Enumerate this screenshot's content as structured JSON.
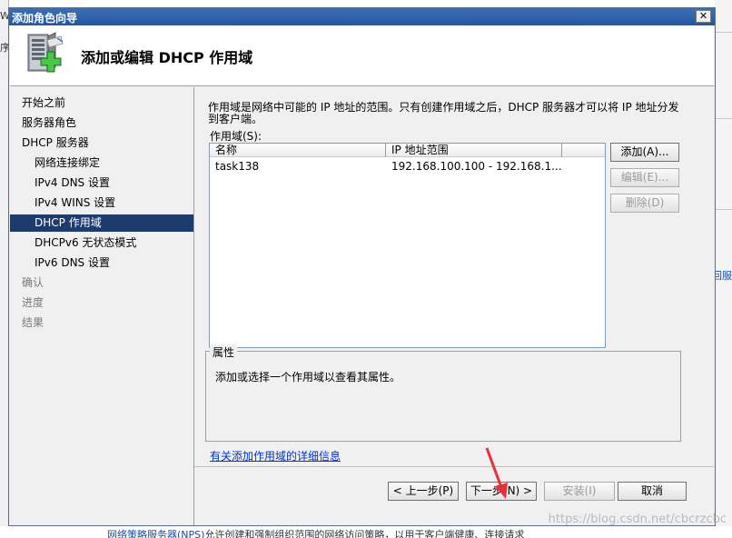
{
  "background": {
    "left_fragments": [
      "W:",
      "序"
    ],
    "right_fragment": "回服",
    "bottom_text_link": "网络策略服务器(NPS)",
    "bottom_text_rest": "允许创建和强制组织范围的网络访问策略，以用于客户端健康、连接请求"
  },
  "watermark": "https://blog.csdn.net/cbcrzcbc",
  "dialog": {
    "title": "添加角色向导",
    "close_glyph": "✕",
    "header_title": "添加或编辑 DHCP 作用域",
    "nav": [
      {
        "label": "开始之前",
        "state": "normal",
        "indent": 0
      },
      {
        "label": "服务器角色",
        "state": "normal",
        "indent": 0
      },
      {
        "label": "DHCP 服务器",
        "state": "normal",
        "indent": 0
      },
      {
        "label": "网络连接绑定",
        "state": "normal",
        "indent": 1
      },
      {
        "label": "IPv4 DNS 设置",
        "state": "normal",
        "indent": 1
      },
      {
        "label": "IPv4 WINS 设置",
        "state": "normal",
        "indent": 1
      },
      {
        "label": "DHCP 作用域",
        "state": "active",
        "indent": 1
      },
      {
        "label": "DHCPv6 无状态模式",
        "state": "normal",
        "indent": 1
      },
      {
        "label": "IPv6 DNS 设置",
        "state": "normal",
        "indent": 1
      },
      {
        "label": "确认",
        "state": "dim",
        "indent": 0
      },
      {
        "label": "进度",
        "state": "dim",
        "indent": 0
      },
      {
        "label": "结果",
        "state": "dim",
        "indent": 0
      }
    ],
    "description": "作用域是网络中可能的 IP 地址的范围。只有创建作用域之后，DHCP 服务器才可以将 IP 地址分发到客户端。",
    "scopes_label": "作用域(S):",
    "columns": [
      "名称",
      "IP 地址范围",
      ""
    ],
    "rows": [
      {
        "name": "task138",
        "range": "192.168.100.100 - 192.168.1..."
      }
    ],
    "buttons": {
      "add": "添加(A)...",
      "edit": "编辑(E)...",
      "delete": "删除(D)"
    },
    "properties_title": "属性",
    "properties_text": "添加或选择一个作用域以查看其属性。",
    "more_info_link": "有关添加作用域的详细信息",
    "footer": {
      "back": "< 上一步(P)",
      "next": "下一步(N) >",
      "install": "安装(I)",
      "cancel": "取消"
    },
    "colors": {
      "titlebar": "#2457a3",
      "nav_active": "#1e3b6e",
      "arrow": "#e8303a"
    }
  }
}
